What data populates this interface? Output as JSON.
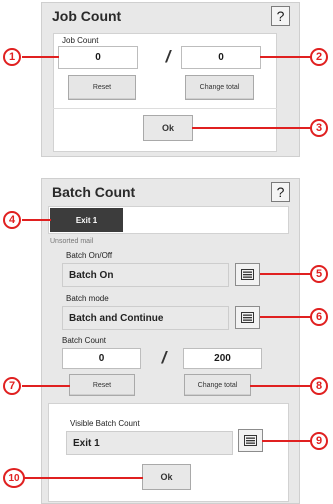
{
  "job_count_dialog": {
    "title": "Job Count",
    "help_label": "?",
    "field_label": "Job Count",
    "current_value": "0",
    "separator": "/",
    "total_value": "0",
    "reset_label": "Reset",
    "change_total_label": "Change total",
    "ok_label": "Ok"
  },
  "batch_count_dialog": {
    "title": "Batch Count",
    "help_label": "?",
    "tabs": [
      {
        "label": "Exit 1",
        "active": true
      }
    ],
    "section_label": "Unsorted mail",
    "batch_onoff_label": "Batch On/Off",
    "batch_onoff_value": "Batch On",
    "batch_mode_label": "Batch mode",
    "batch_mode_value": "Batch and Continue",
    "batch_count_label": "Batch Count",
    "current_value": "0",
    "separator": "/",
    "total_value": "200",
    "reset_label": "Reset",
    "change_total_label": "Change total",
    "visible_batch_label": "Visible Batch Count",
    "visible_batch_value": "Exit 1",
    "ok_label": "Ok"
  },
  "callouts": [
    "1",
    "2",
    "3",
    "4",
    "5",
    "6",
    "7",
    "8",
    "9",
    "10"
  ],
  "colors": {
    "callout": "#e02020",
    "tab_active": "#3c3c3c",
    "panel": "#e8e8e8"
  },
  "icons": [
    "list-icon"
  ]
}
